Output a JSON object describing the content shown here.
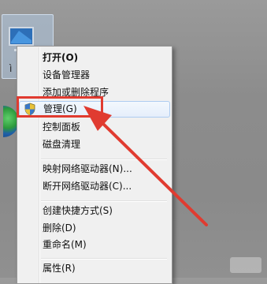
{
  "desktop": {
    "selected_icon_label": "ì"
  },
  "menu": {
    "items": [
      {
        "label": "打开(O)",
        "bold": true
      },
      {
        "label": "设备管理器"
      },
      {
        "label": "添加或删除程序"
      },
      {
        "label": "管理(G)",
        "highlighted": true,
        "icon": "uac-shield-icon"
      },
      {
        "label": "控制面板"
      },
      {
        "label": "磁盘清理"
      },
      {
        "label": "映射网络驱动器(N)..."
      },
      {
        "label": "断开网络驱动器(C)..."
      },
      {
        "label": "创建快捷方式(S)"
      },
      {
        "label": "删除(D)"
      },
      {
        "label": "重命名(M)"
      },
      {
        "label": "属性(R)"
      }
    ]
  },
  "colors": {
    "annotation_red": "#e03b30",
    "highlight_border": "#aeccf0",
    "menu_bg": "#f0f0f0"
  }
}
